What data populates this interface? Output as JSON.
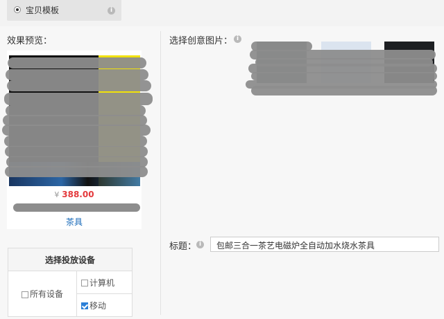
{
  "template": {
    "label": "宝贝模板"
  },
  "preview": {
    "heading": "效果预览：",
    "currency": "¥",
    "price": "388.00",
    "category_link": "茶具"
  },
  "creative": {
    "heading": "选择创意图片："
  },
  "title_field": {
    "label": "标题：",
    "value": "包邮三合一茶艺电磁炉全自动加水烧水茶具"
  },
  "devices": {
    "heading": "选择投放设备",
    "all_label": "所有设备",
    "all_checked": false,
    "computer_label": "计算机",
    "computer_checked": false,
    "mobile_label": "移动",
    "mobile_checked": true
  },
  "colors": {
    "price": "#e4393c",
    "link": "#1668b8",
    "checkbox_on": "#2b7fd7"
  },
  "icons": {
    "info": "info-icon",
    "radio": "radio-selected-icon"
  }
}
